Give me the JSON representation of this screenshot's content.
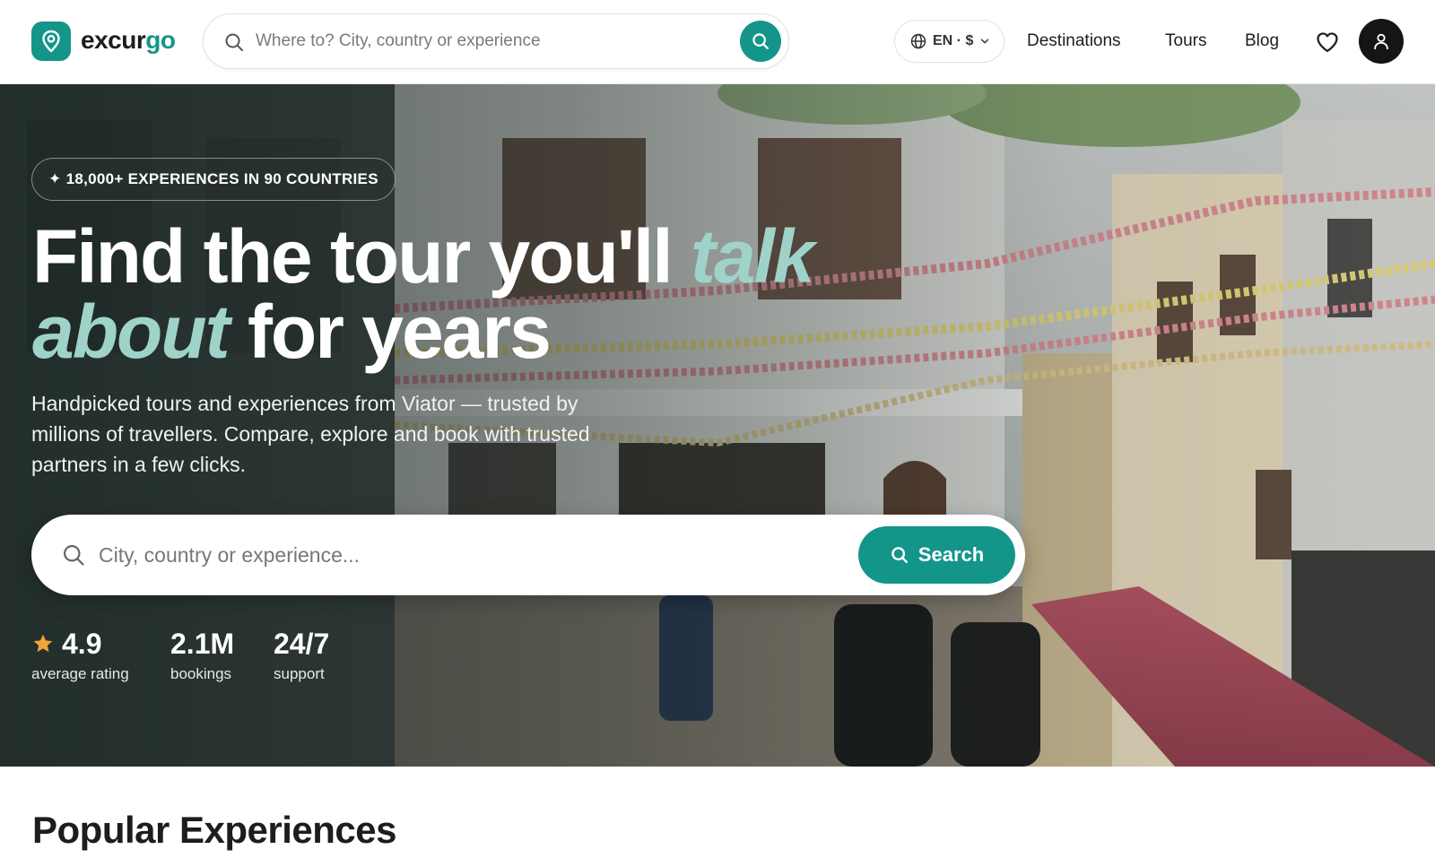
{
  "brand": {
    "name_main": "excur",
    "name_accent": "go",
    "colors": {
      "primary": "#14958a",
      "accent_text": "#9fd3c9",
      "dark": "#151515"
    },
    "logo_icon": "map-pin-icon"
  },
  "header": {
    "search": {
      "placeholder": "Where to? City, country or experience",
      "button_icon": "search-icon"
    },
    "locale": {
      "label": "EN · $",
      "icon": "globe-icon"
    },
    "nav": [
      {
        "label": "Destinations"
      },
      {
        "label": "Tours"
      },
      {
        "label": "Blog"
      }
    ],
    "wishlist_icon": "heart-icon",
    "account_icon": "user-icon"
  },
  "hero": {
    "badge": "✦ 18,000+ EXPERIENCES IN 90 COUNTRIES",
    "title_part1": "Find the tour you'll ",
    "title_highlight1": "talk",
    "title_highlight2": "about",
    "title_part2": " for years",
    "subtitle": "Handpicked tours and experiences from Viator — trusted by millions of travellers. Compare, explore and book with trusted partners in a few clicks.",
    "search": {
      "placeholder": "City, country or experience...",
      "button_label": "Search"
    },
    "stats": [
      {
        "value": "4.9",
        "label": "average rating",
        "icon": "star-icon"
      },
      {
        "value": "2.1M",
        "label": "bookings"
      },
      {
        "value": "24/7",
        "label": "support"
      }
    ]
  },
  "sections": {
    "popular_title": "Popular Experiences"
  }
}
